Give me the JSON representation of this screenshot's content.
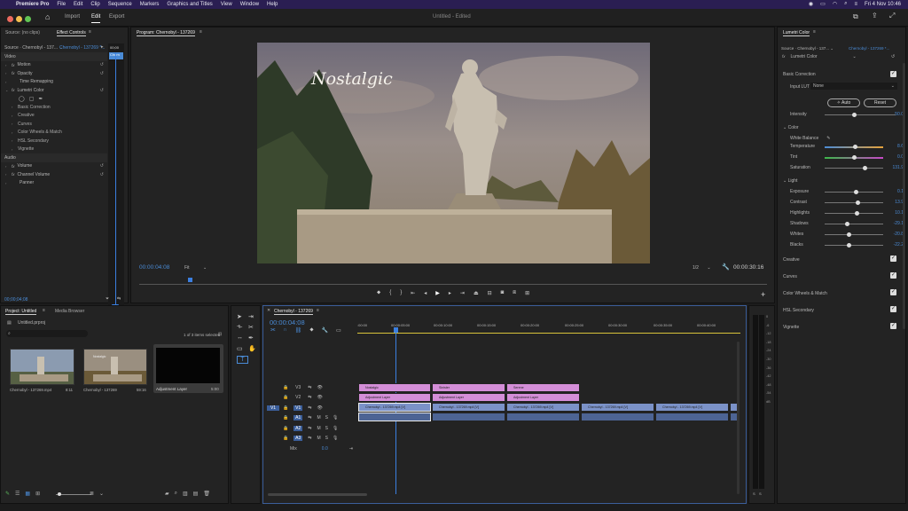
{
  "menubar": {
    "apple_icon": "apple-logo",
    "app": "Premiere Pro",
    "items": [
      "File",
      "Edit",
      "Clip",
      "Sequence",
      "Markers",
      "Graphics and Titles",
      "View",
      "Window",
      "Help"
    ],
    "clock": "Fri 4 Nov  10:46"
  },
  "header": {
    "tabs": [
      "Import",
      "Edit",
      "Export"
    ],
    "active_tab": "Edit",
    "title": "Untitled",
    "status": "- Edited"
  },
  "source_panel": {
    "tabs": [
      "Source: (no clips)",
      "Effect Controls"
    ],
    "source_dropdown": "Source · Chernobyl - 137...",
    "clip_dropdown": "Chernobyl - 137269 *...",
    "mini_label": "Chern",
    "mini_time": "00;00",
    "sections": {
      "video": "Video",
      "audio": "Audio"
    },
    "video_effects": [
      "Motion",
      "Opacity",
      "Time Remapping",
      "Lumetri Color"
    ],
    "lumetri_sub": [
      "Basic Correction",
      "Creative",
      "Curves",
      "Color Wheels & Match",
      "HSL Secondary",
      "Vignette"
    ],
    "audio_effects": [
      "Volume",
      "Channel Volume",
      "Panner"
    ],
    "timecode": "00;00;04;08"
  },
  "program": {
    "title": "Program: Chernobyl - 137269",
    "overlay_text": "Nostalgic",
    "timecode": "00:00:04:08",
    "fit": "Fit",
    "quality": "1/2",
    "duration": "00:00:30:16"
  },
  "project": {
    "tabs": [
      "Project: Untitled",
      "Media Browser"
    ],
    "file": "Untitled.prproj",
    "selection": "1 of 3 items selected",
    "items": [
      {
        "name": "Chernobyl - 137269.mp4",
        "duration": "8:11"
      },
      {
        "name": "Chernobyl - 137269",
        "duration": "59:16"
      },
      {
        "name": "Adjustment Layer",
        "duration": "5:00"
      }
    ],
    "thumb_label": "Nostalgic"
  },
  "timeline": {
    "title": "Chernobyl - 137269",
    "timecode": "00:00:04:08",
    "ruler": [
      ":00:00",
      "00:00:05:00",
      "00:00:10:00",
      "00:00:15:00",
      "00:00:20:00",
      "00:00:25:00",
      "00:00:30:00",
      "00:00:35:00",
      "00:00:40:00"
    ],
    "video_tracks": [
      "V3",
      "V2",
      "V1"
    ],
    "audio_tracks": [
      "A1",
      "A2",
      "A3"
    ],
    "mix_label": "Mix",
    "mix_value": "0.0",
    "text_clips": [
      "Nostalgic",
      "Sinister",
      "Serene"
    ],
    "adjustment_clip": "Adjustment Layer",
    "video_clip": "Chernobyl - 137269.mp4 [V]"
  },
  "meter": {
    "ticks": [
      "0",
      "-6",
      "-12",
      "-18",
      "-24",
      "-30",
      "-36",
      "-42",
      "-48",
      "-54",
      "dB"
    ],
    "solo": [
      "S",
      "S"
    ]
  },
  "lumetri": {
    "title": "Lumetri Color",
    "source": "Source · Chernobyl - 137...",
    "clip": "Chernobyl - 137269 *...",
    "effect": "Lumetri Color",
    "basic_correction": "Basic Correction",
    "input_lut_label": "Input LUT",
    "input_lut_value": "None",
    "auto": "Auto",
    "reset": "Reset",
    "intensity": {
      "label": "Intensity",
      "value": "50.0"
    },
    "color_section": "Color",
    "white_balance": "White Balance",
    "temperature": {
      "label": "Temperature",
      "value": "8.6"
    },
    "tint": {
      "label": "Tint",
      "value": "0.0"
    },
    "saturation": {
      "label": "Saturation",
      "value": "131.9"
    },
    "light_section": "Light",
    "exposure": {
      "label": "Exposure",
      "value": "0.1"
    },
    "contrast": {
      "label": "Contrast",
      "value": "13.9"
    },
    "highlights": {
      "label": "Highlights",
      "value": "10.1"
    },
    "shadows": {
      "label": "Shadows",
      "value": "-29.1"
    },
    "whites": {
      "label": "Whites",
      "value": "-20.8"
    },
    "blacks": {
      "label": "Blacks",
      "value": "-22.2"
    },
    "sections": [
      "Creative",
      "Curves",
      "Color Wheels & Match",
      "HSL Secondary",
      "Vignette"
    ]
  },
  "colors": {
    "accent": "#4a8bd6",
    "menubar": "#2a1e52",
    "playhead": "#3b7fe0",
    "text_clip": "#d48ed8",
    "video_clip": "#7b92c8"
  }
}
